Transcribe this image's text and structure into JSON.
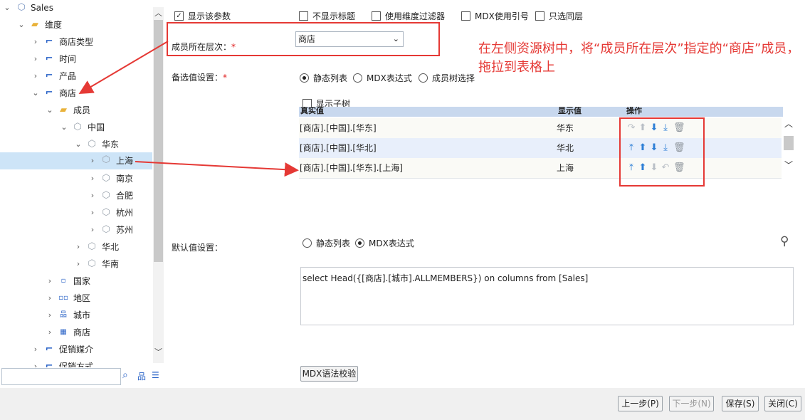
{
  "tree": {
    "nodes": [
      {
        "label": "Sales",
        "icon": "cube-icon",
        "arrow": "down"
      },
      {
        "label": "维度",
        "icon": "dimension-folder-icon",
        "arrow": "down"
      },
      {
        "label": "商店类型",
        "icon": "dimension-icon",
        "arrow": "right"
      },
      {
        "label": "时间",
        "icon": "dimension-icon",
        "arrow": "right"
      },
      {
        "label": "产品",
        "icon": "dimension-icon",
        "arrow": "right"
      },
      {
        "label": "商店",
        "icon": "dimension-icon",
        "arrow": "down"
      },
      {
        "label": "成员",
        "icon": "member-folder-icon",
        "arrow": "down"
      },
      {
        "label": "中国",
        "icon": "cube-icon",
        "arrow": "down"
      },
      {
        "label": "华东",
        "icon": "cube-icon",
        "arrow": "down"
      },
      {
        "label": "上海",
        "icon": "cube-icon",
        "arrow": "right"
      },
      {
        "label": "南京",
        "icon": "cube-icon",
        "arrow": "right"
      },
      {
        "label": "合肥",
        "icon": "cube-icon",
        "arrow": "right"
      },
      {
        "label": "杭州",
        "icon": "cube-icon",
        "arrow": "right"
      },
      {
        "label": "苏州",
        "icon": "cube-icon",
        "arrow": "right"
      },
      {
        "label": "华北",
        "icon": "cube-icon",
        "arrow": "right"
      },
      {
        "label": "华南",
        "icon": "cube-icon",
        "arrow": "right"
      },
      {
        "label": "国家",
        "icon": "level-1-icon",
        "arrow": "right"
      },
      {
        "label": "地区",
        "icon": "level-2-icon",
        "arrow": "right"
      },
      {
        "label": "城市",
        "icon": "level-3-icon",
        "arrow": "right"
      },
      {
        "label": "商店",
        "icon": "level-4-icon",
        "arrow": "right"
      },
      {
        "label": "促销媒介",
        "icon": "dimension-icon",
        "arrow": "right"
      },
      {
        "label": "促销方式",
        "icon": "dimension-icon",
        "arrow": "right"
      }
    ],
    "search_placeholder": ""
  },
  "options": {
    "show_param": "显示该参数",
    "hide_title": "不显示标题",
    "use_dim_filter": "使用维度过滤器",
    "mdx_quote": "MDX使用引号",
    "single_level": "只选同层"
  },
  "level": {
    "label": "成员所在层次：",
    "required": "*",
    "value": "商店"
  },
  "annotation": "在左侧资源树中，将“成员所在层次”指定的“商店”成员，拖拉到表格上",
  "candidates": {
    "label": "备选值设置：",
    "required": "*",
    "radio_static": "静态列表",
    "radio_mdx": "MDX表达式",
    "radio_tree": "成员树选择",
    "show_subtree": "显示子树",
    "headers": [
      "真实值",
      "显示值",
      "操作"
    ],
    "rows": [
      {
        "real": "[商店].[中国].[华东]",
        "display": "华东"
      },
      {
        "real": "[商店].[中国].[华北]",
        "display": "华北"
      },
      {
        "real": "[商店].[中国].[华东].[上海]",
        "display": "上海"
      }
    ]
  },
  "default": {
    "label": "默认值设置：",
    "radio_static": "静态列表",
    "radio_mdx": "MDX表达式",
    "mdx": "select Head({[商店].[城市].ALLMEMBERS}) on columns from [Sales]"
  },
  "buttons": {
    "mdx_check": "MDX语法校验",
    "prev": "上一步(P)",
    "next": "下一步(N)",
    "save": "保存(S)",
    "close": "关闭(C)"
  },
  "colors": {
    "accent": "#2e7fd6",
    "annotation": "#e53935",
    "selection": "#cde4f7"
  }
}
